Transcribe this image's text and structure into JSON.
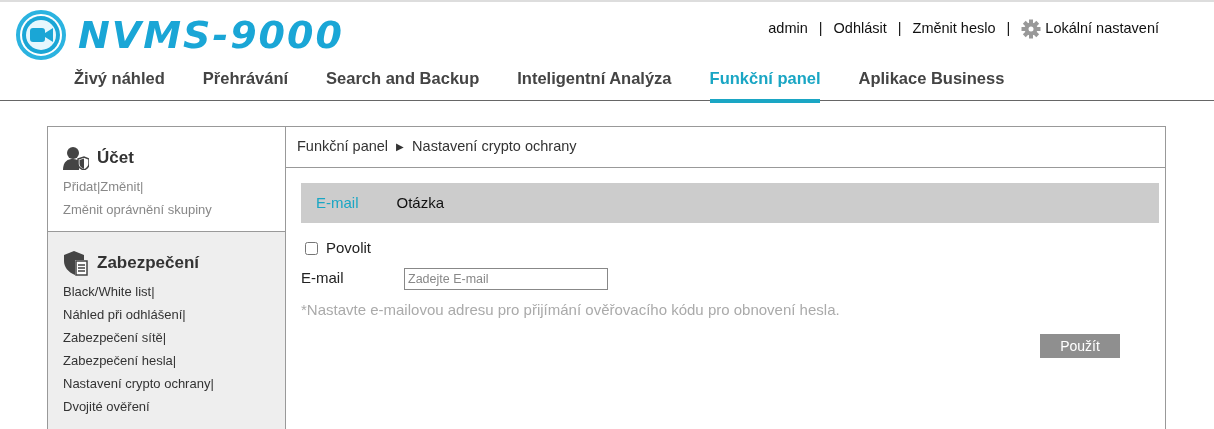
{
  "logo": {
    "text": "NVMS-9000"
  },
  "user_menu": [
    {
      "kind": "text",
      "text": "admin"
    },
    {
      "kind": "sep",
      "text": "|"
    },
    {
      "kind": "link",
      "text": "Odhlásit"
    },
    {
      "kind": "sep",
      "text": "|"
    },
    {
      "kind": "link",
      "text": "Změnit heslo"
    },
    {
      "kind": "sep",
      "text": "|"
    },
    {
      "kind": "settings",
      "text": "Lokální nastavení"
    }
  ],
  "nav": [
    {
      "label": "Živý náhled",
      "selected": false
    },
    {
      "label": "Přehrávání",
      "selected": false
    },
    {
      "label": "Search and Backup",
      "selected": false
    },
    {
      "label": "Inteligentní Analýza",
      "selected": false
    },
    {
      "label": "Funkční panel",
      "selected": true
    },
    {
      "label": "Aplikace Business",
      "selected": false
    }
  ],
  "sidebar": [
    {
      "title": "Účet",
      "kind": "account",
      "selected": false,
      "lines": [
        [
          "Přidat|",
          "Změnit|"
        ],
        [
          "Změnit oprávnění skupiny"
        ]
      ]
    },
    {
      "title": "Zabezpečení",
      "kind": "security",
      "selected": true,
      "lines": [
        [
          "Black/White list|"
        ],
        [
          "Náhled při odhlášení|"
        ],
        [
          "Zabezpečení sítě|"
        ],
        [
          "Zabezpečení hesla|"
        ],
        [
          "Nastavení crypto ochrany|"
        ],
        [
          "Dvojité ověření"
        ]
      ]
    }
  ],
  "breadcrumb": {
    "parent": "Funkční panel",
    "separator": "▶",
    "current": "Nastavení crypto ochrany"
  },
  "tabs": [
    {
      "label": "E-mail",
      "selected": true
    },
    {
      "label": "Otázka",
      "selected": false
    }
  ],
  "form": {
    "enable": {
      "label": "Povolit",
      "checked": false
    },
    "email": {
      "label": "E-mail",
      "placeholder": "Zadejte E-mail"
    },
    "hint": "*Nastavte e-mailovou adresu pro přijímání ověřovacího kódu pro obnovení hesla.",
    "apply": "Použít"
  }
}
